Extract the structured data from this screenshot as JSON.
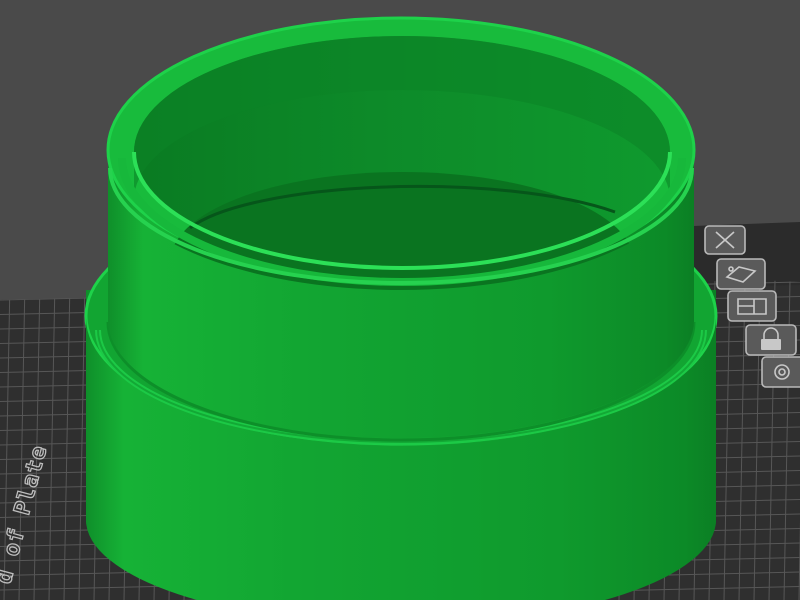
{
  "viewport": {
    "build_plate_label": "d of Plate"
  },
  "object_toolbar": {
    "items": [
      {
        "name": "delete",
        "icon": "close-x-icon"
      },
      {
        "name": "arrange",
        "icon": "arrange-icon"
      },
      {
        "name": "layout",
        "icon": "layout-icon"
      },
      {
        "name": "lock",
        "icon": "lock-icon"
      },
      {
        "name": "settings",
        "icon": "gear-icon"
      }
    ]
  },
  "model": {
    "shape": "stepped cylindrical ring",
    "color": "#11a12f"
  },
  "colors": {
    "background": "#4a4a4a",
    "plate": "#2f2f2f",
    "grid": "#555555",
    "model_body": "#11a12f",
    "model_highlight": "#1ed24a",
    "model_shadow": "#0a7a22"
  }
}
